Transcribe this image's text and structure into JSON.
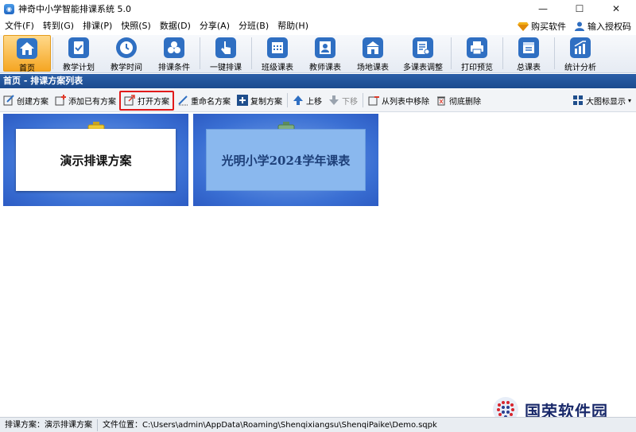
{
  "window": {
    "title": "神奇中小学智能排课系统 5.0",
    "minimize": "—",
    "maximize": "☐",
    "close": "✕"
  },
  "menu": {
    "items": [
      "文件(F)",
      "转到(G)",
      "排课(P)",
      "快照(S)",
      "数据(D)",
      "分享(A)",
      "分班(B)",
      "帮助(H)"
    ],
    "buy": "购买软件",
    "license": "输入授权码"
  },
  "ribbon": {
    "items": [
      {
        "label": "首页",
        "icon": "home-icon"
      },
      {
        "label": "教学计划",
        "icon": "teaching-plan-icon"
      },
      {
        "label": "教学时间",
        "icon": "clock-icon"
      },
      {
        "label": "排课条件",
        "icon": "conditions-icon"
      },
      {
        "label": "一键排课",
        "icon": "one-click-icon"
      },
      {
        "label": "班级课表",
        "icon": "class-timetable-icon"
      },
      {
        "label": "教师课表",
        "icon": "teacher-timetable-icon"
      },
      {
        "label": "场地课表",
        "icon": "venue-timetable-icon"
      },
      {
        "label": "多课表调整",
        "icon": "multi-adjust-icon"
      },
      {
        "label": "打印预览",
        "icon": "printer-icon"
      },
      {
        "label": "总课表",
        "icon": "master-timetable-icon"
      },
      {
        "label": "统计分析",
        "icon": "chart-icon"
      }
    ]
  },
  "breadcrumb": "首页 - 排课方案列表",
  "toolbar": {
    "create": "创建方案",
    "add_existing": "添加已有方案",
    "open": "打开方案",
    "rename": "重命名方案",
    "copy": "复制方案",
    "move_up": "上移",
    "move_down": "下移",
    "remove_from_list": "从列表中移除",
    "delete": "彻底删除",
    "view_mode": "大图标显示"
  },
  "plans": [
    {
      "name": "演示排课方案",
      "selected": true
    },
    {
      "name": "光明小学2024学年课表",
      "selected": false
    }
  ],
  "status": {
    "plan": "排课方案：演示排课方案",
    "location": "文件位置：C:\\Users\\admin\\AppData\\Roaming\\Shenqixiangsu\\ShenqiPaike\\Demo.sqpk"
  },
  "watermark": "国荣软件园",
  "colors": {
    "accent": "#2f6fc2",
    "active_tab": "#f5a623",
    "highlight": "#e11a1a",
    "breadcrumb_bg": "#1c4b8e"
  }
}
